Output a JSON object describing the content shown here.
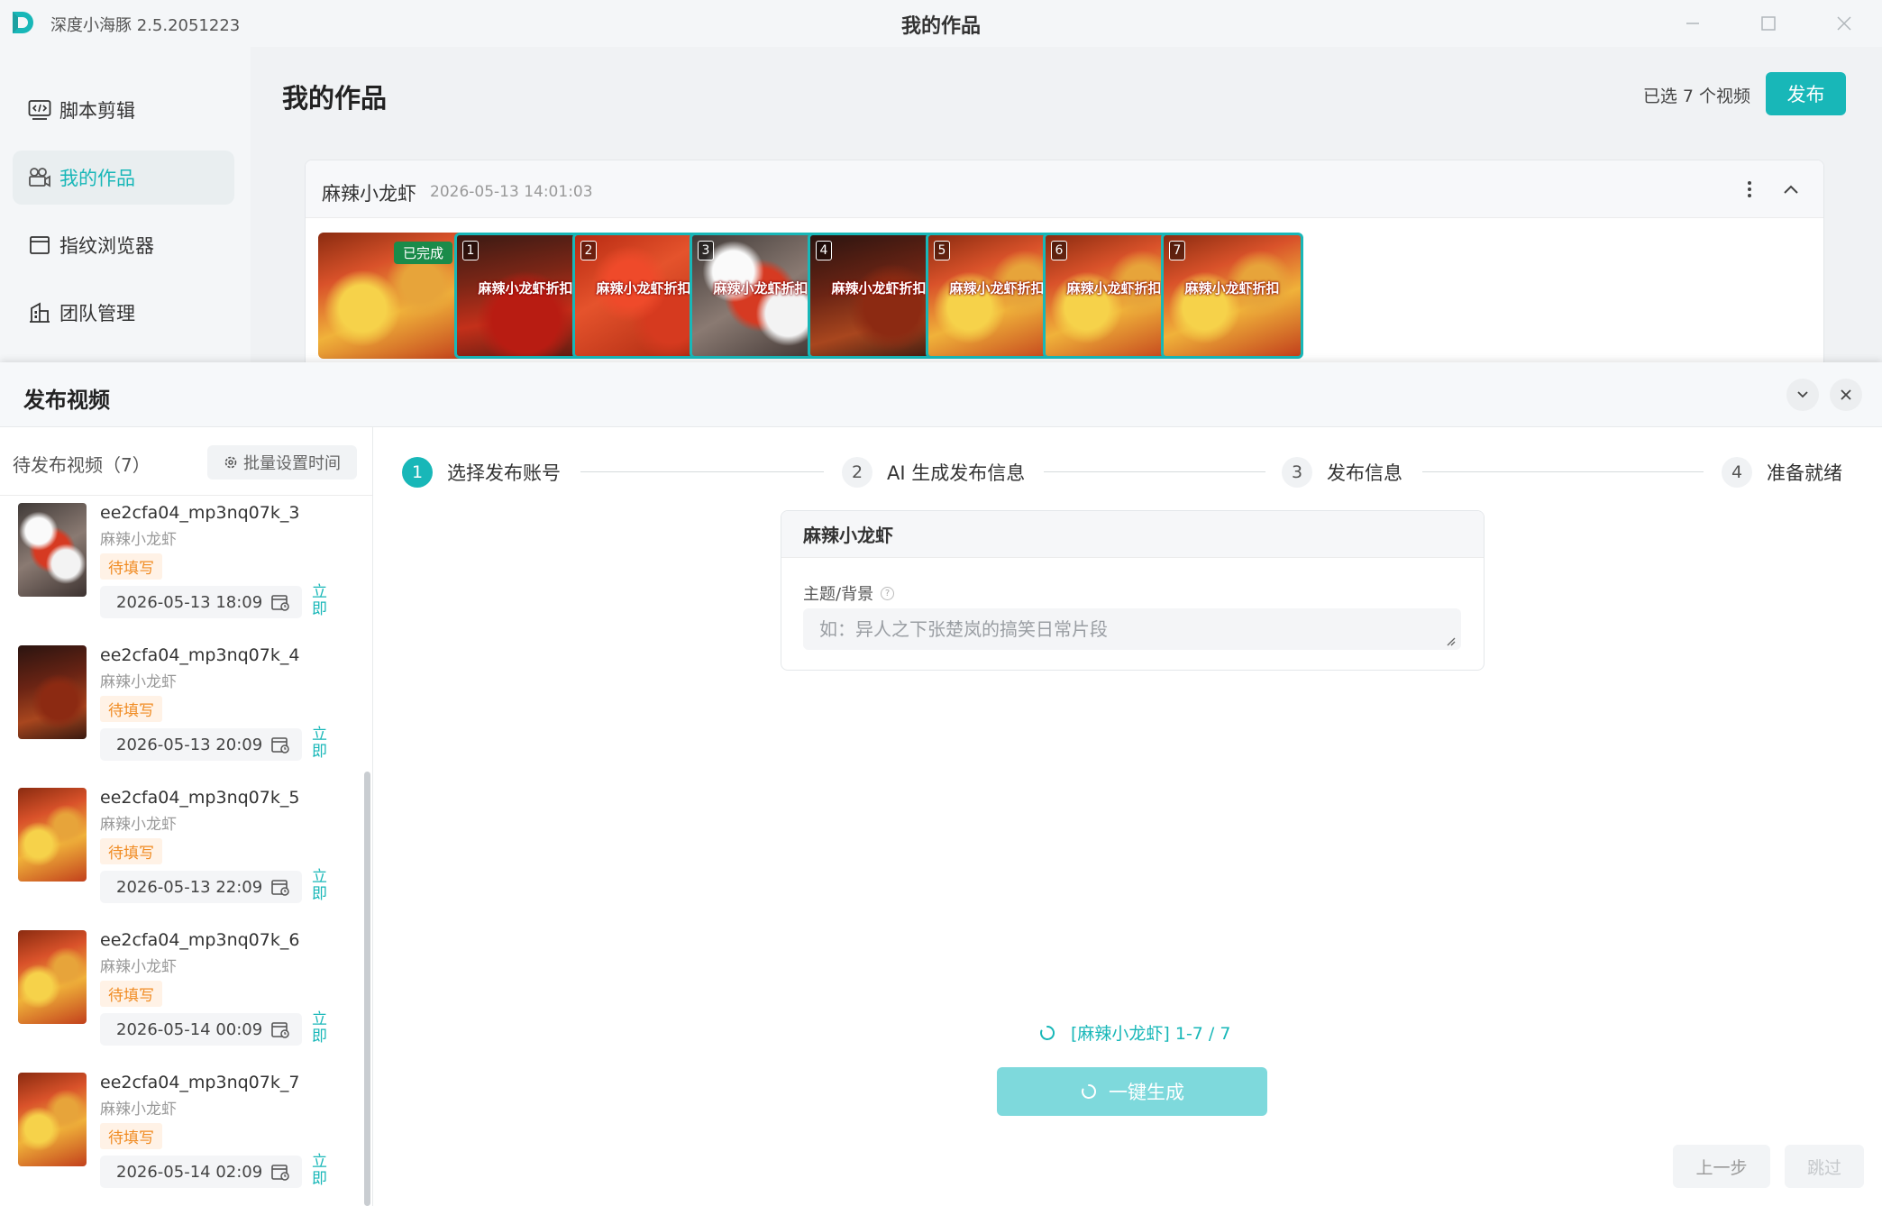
{
  "app": {
    "name": "深度小海豚 2.5.2051223",
    "window_title": "我的作品",
    "brand_color": "#18b7b8"
  },
  "sidebar": {
    "items": [
      {
        "label": "脚本剪辑",
        "icon": "code-icon"
      },
      {
        "label": "我的作品",
        "icon": "film-camera-icon",
        "active": true
      },
      {
        "label": "指纹浏览器",
        "icon": "browser-window-icon"
      },
      {
        "label": "团队管理",
        "icon": "team-building-icon"
      }
    ]
  },
  "main": {
    "title": "我的作品",
    "selected_count": "已选 7 个视频",
    "publish_label": "发布",
    "project": {
      "name": "麻辣小龙虾",
      "time": "2026-05-13 14:01:03",
      "done_badge": "已完成",
      "thumbnails": [
        {
          "num": "1",
          "caption": "麻辣小龙虾折扣"
        },
        {
          "num": "2",
          "caption": "麻辣小龙虾折扣"
        },
        {
          "num": "3",
          "caption": "麻辣小龙虾折扣"
        },
        {
          "num": "4",
          "caption": "麻辣小龙虾折扣"
        },
        {
          "num": "5",
          "caption": "麻辣小龙虾折扣"
        },
        {
          "num": "6",
          "caption": "麻辣小龙虾折扣"
        },
        {
          "num": "7",
          "caption": "麻辣小龙虾折扣"
        }
      ]
    }
  },
  "publish_panel": {
    "title": "发布视频",
    "list_title": "待发布视频（7）",
    "batch_time_label": "批量设置时间",
    "videos": [
      {
        "name": "ee2cfa04_mp3nq07k_3",
        "project": "麻辣小龙虾",
        "status": "待填写",
        "date": "2026-05-13 18:09",
        "now": "立即"
      },
      {
        "name": "ee2cfa04_mp3nq07k_4",
        "project": "麻辣小龙虾",
        "status": "待填写",
        "date": "2026-05-13 20:09",
        "now": "立即"
      },
      {
        "name": "ee2cfa04_mp3nq07k_5",
        "project": "麻辣小龙虾",
        "status": "待填写",
        "date": "2026-05-13 22:09",
        "now": "立即"
      },
      {
        "name": "ee2cfa04_mp3nq07k_6",
        "project": "麻辣小龙虾",
        "status": "待填写",
        "date": "2026-05-14 00:09",
        "now": "立即"
      },
      {
        "name": "ee2cfa04_mp3nq07k_7",
        "project": "麻辣小龙虾",
        "status": "待填写",
        "date": "2026-05-14 02:09",
        "now": "立即"
      }
    ],
    "steps": [
      {
        "num": "1",
        "label": "选择发布账号",
        "active": true
      },
      {
        "num": "2",
        "label": "AI 生成发布信息"
      },
      {
        "num": "3",
        "label": "发布信息"
      },
      {
        "num": "4",
        "label": "准备就绪"
      }
    ],
    "form": {
      "card_title": "麻辣小龙虾",
      "topic_label": "主题/背景",
      "topic_help": "?",
      "topic_value": "",
      "topic_placeholder": "如：异人之下张楚岚的搞笑日常片段"
    },
    "progress_text": "[麻辣小龙虾] 1-7 / 7",
    "generate_label": "一键生成",
    "prev_label": "上一步",
    "skip_label": "跳过"
  }
}
